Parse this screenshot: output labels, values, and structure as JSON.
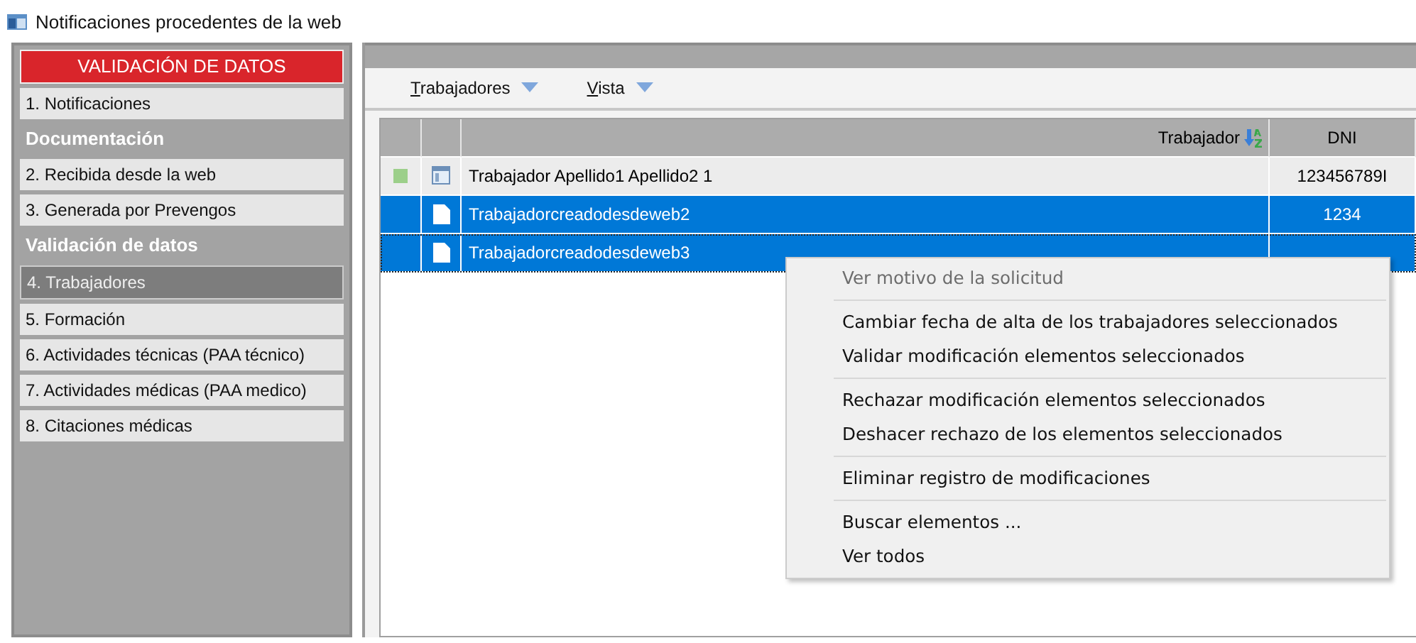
{
  "window": {
    "title": "Notificaciones procedentes de la web"
  },
  "sidebar": {
    "items": [
      {
        "kind": "banner",
        "label": "VALIDACIÓN DE DATOS"
      },
      {
        "kind": "item",
        "label": "1. Notificaciones",
        "selected": false
      },
      {
        "kind": "section",
        "label": "Documentación"
      },
      {
        "kind": "item",
        "label": "2. Recibida desde la web",
        "selected": false
      },
      {
        "kind": "item",
        "label": "3. Generada por Prevengos",
        "selected": false
      },
      {
        "kind": "section",
        "label": "Validación de datos"
      },
      {
        "kind": "item",
        "label": "4. Trabajadores",
        "selected": true
      },
      {
        "kind": "item",
        "label": "5. Formación",
        "selected": false
      },
      {
        "kind": "item",
        "label": "6. Actividades técnicas (PAA técnico)",
        "selected": false
      },
      {
        "kind": "item",
        "label": "7. Actividades médicas (PAA medico)",
        "selected": false
      },
      {
        "kind": "item",
        "label": "8. Citaciones médicas",
        "selected": false
      }
    ]
  },
  "toolbar": {
    "menus": [
      "Trabajadores",
      "Vista"
    ]
  },
  "table": {
    "columns": [
      "Trabajador",
      "DNI"
    ],
    "rows": [
      {
        "kind": "form",
        "marked": true,
        "selected": false,
        "focused": false,
        "trabajador": "Trabajador Apellido1 Apellido2 1",
        "dni": "123456789I"
      },
      {
        "kind": "document",
        "marked": false,
        "selected": true,
        "focused": false,
        "trabajador": "Trabajadorcreadodesdeweb2",
        "dni": "1234"
      },
      {
        "kind": "document",
        "marked": false,
        "selected": true,
        "focused": true,
        "trabajador": "Trabajadorcreadodesdeweb3"
      }
    ]
  },
  "context_menu": {
    "groups": [
      [
        {
          "label": "Ver motivo de la solicitud",
          "disabled": true
        }
      ],
      [
        {
          "label": "Cambiar fecha de alta de los trabajadores seleccionados",
          "disabled": false
        },
        {
          "label": "Validar modificación elementos seleccionados",
          "disabled": false
        }
      ],
      [
        {
          "label": "Rechazar modificación elementos seleccionados",
          "disabled": false
        },
        {
          "label": "Deshacer rechazo de los elementos seleccionados",
          "disabled": false
        }
      ],
      [
        {
          "label": "Eliminar registro de modificaciones",
          "disabled": false
        }
      ],
      [
        {
          "label": "Buscar elementos ...",
          "disabled": false
        },
        {
          "label": "Ver todos",
          "disabled": false
        }
      ]
    ]
  }
}
